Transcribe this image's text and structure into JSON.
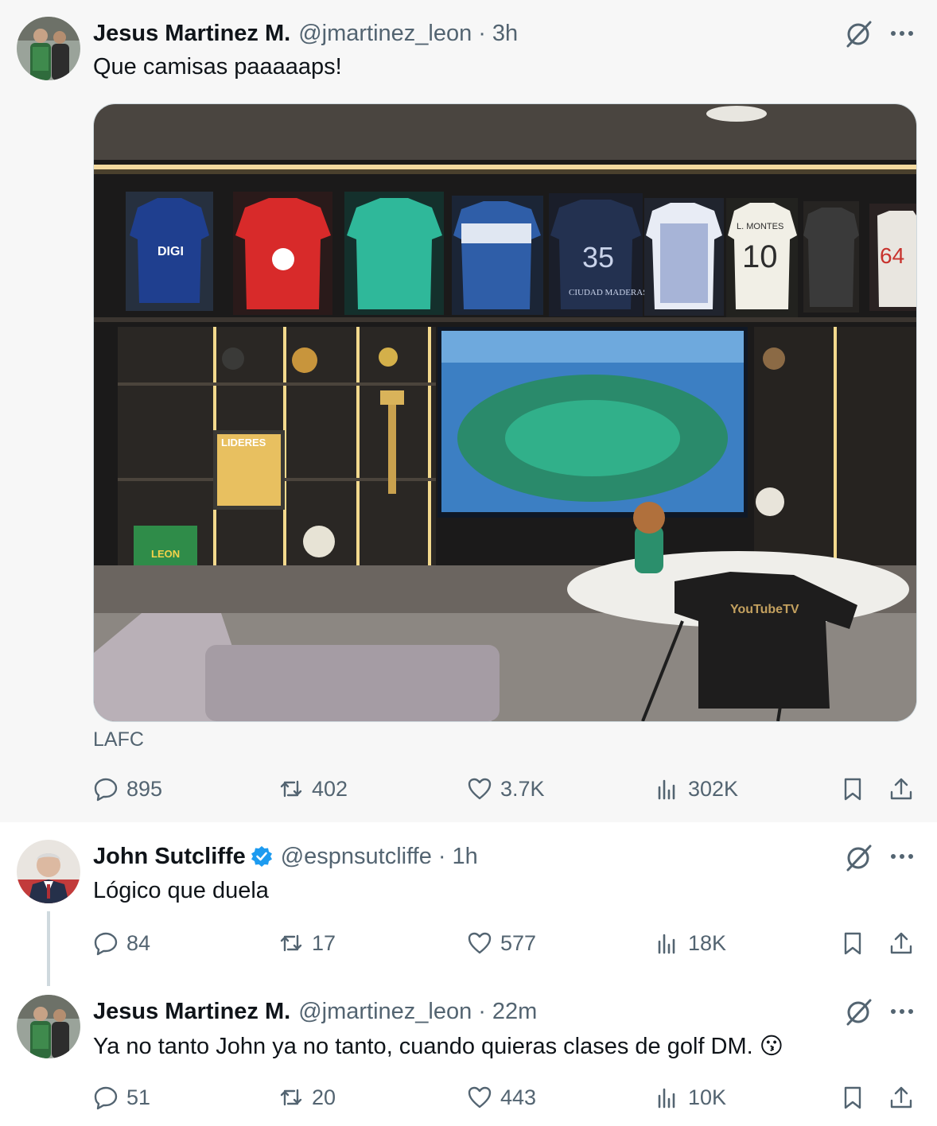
{
  "tweets": [
    {
      "name": "Jesus Martinez M.",
      "handle": "@jmartinez_leon",
      "separator": "·",
      "time": "3h",
      "text": "Que camisas paaaaaps!",
      "verified": false,
      "media": {
        "caption": "LAFC",
        "shirt_labels": {
          "brand_1": "DIGI",
          "brand_2": "CIUDAD MADERAS",
          "number_1": "35",
          "name_back": "L. MONTES",
          "number_2": "10",
          "number_3": "64",
          "book_title": "LIDERES",
          "case_label": "LEON",
          "shirt_sponsor": "YouTubeTV"
        }
      },
      "stats": {
        "replies": "895",
        "reposts": "402",
        "likes": "3.7K",
        "views": "302K"
      }
    },
    {
      "name": "John Sutcliffe",
      "handle": "@espnsutcliffe",
      "separator": "·",
      "time": "1h",
      "text": "Lógico que duela",
      "verified": true,
      "stats": {
        "replies": "84",
        "reposts": "17",
        "likes": "577",
        "views": "18K"
      }
    },
    {
      "name": "Jesus Martinez M.",
      "handle": "@jmartinez_leon",
      "separator": "·",
      "time": "22m",
      "text": "Ya no tanto John ya no tanto, cuando quieras clases de golf DM.",
      "emoji": "😗",
      "verified": false,
      "stats": {
        "replies": "51",
        "reposts": "20",
        "likes": "443",
        "views": "10K"
      }
    }
  ],
  "icons": {
    "reply": "reply-icon",
    "repost": "repost-icon",
    "like": "heart-icon",
    "views": "views-icon",
    "bookmark": "bookmark-icon",
    "share": "share-icon",
    "grok": "grok-icon",
    "more": "more-icon",
    "verified": "verified-badge-icon"
  },
  "colors": {
    "text": "#0f1419",
    "secondary": "#536471",
    "verified": "#1d9bf0",
    "thread_line": "#cfd9de",
    "highlight_bg": "#f7f7f7"
  }
}
